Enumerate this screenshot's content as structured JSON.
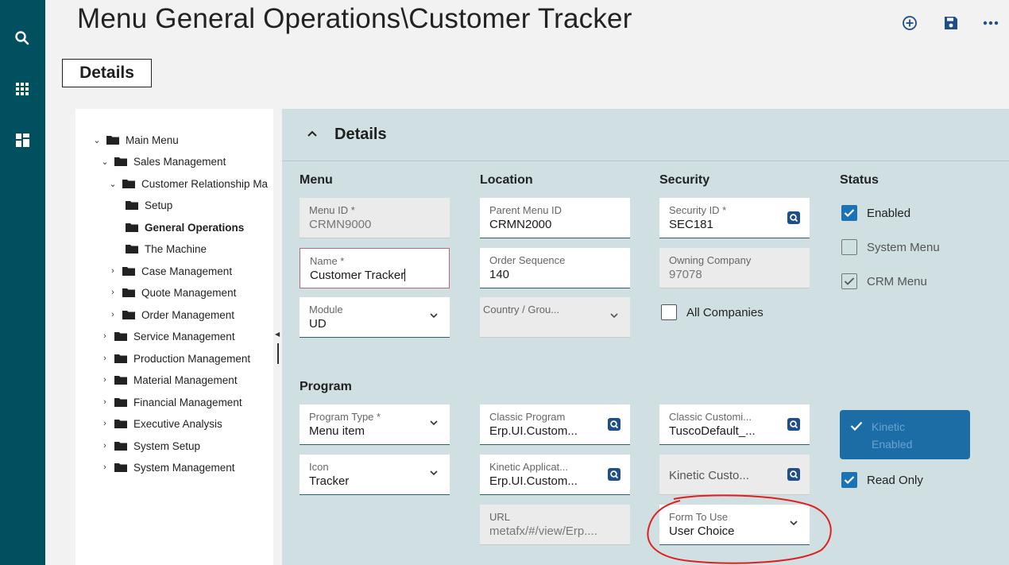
{
  "header": {
    "title": "Menu General Operations\\Customer Tracker",
    "tab": "Details"
  },
  "tree": [
    {
      "label": "Main Menu",
      "expanded": true,
      "bold": false
    },
    {
      "label": "Sales Management",
      "expanded": true,
      "bold": false
    },
    {
      "label": "Customer Relationship Ma",
      "expanded": true,
      "bold": false
    },
    {
      "label": "Setup",
      "bold": false
    },
    {
      "label": "General Operations",
      "bold": true
    },
    {
      "label": "The Machine",
      "bold": false
    },
    {
      "label": "Case Management",
      "expanded": false,
      "bold": false
    },
    {
      "label": "Quote Management",
      "expanded": false,
      "bold": false
    },
    {
      "label": "Order Management",
      "expanded": false,
      "bold": false
    },
    {
      "label": "Service Management",
      "expanded": false,
      "bold": false
    },
    {
      "label": "Production Management",
      "expanded": false,
      "bold": false
    },
    {
      "label": "Material Management",
      "expanded": false,
      "bold": false
    },
    {
      "label": "Financial Management",
      "expanded": false,
      "bold": false
    },
    {
      "label": "Executive Analysis",
      "expanded": false,
      "bold": false
    },
    {
      "label": "System Setup",
      "expanded": false,
      "bold": false
    },
    {
      "label": "System Management",
      "expanded": false,
      "bold": false
    }
  ],
  "panel": {
    "title": "Details",
    "columns": {
      "menu": "Menu",
      "location": "Location",
      "security": "Security",
      "status": "Status",
      "program": "Program"
    },
    "fields": {
      "menu_id": {
        "label": "Menu ID *",
        "value": "CRMN9000"
      },
      "name": {
        "label": "Name *",
        "value": "Customer Tracker"
      },
      "module": {
        "label": "Module",
        "value": "UD"
      },
      "parent_menu_id": {
        "label": "Parent Menu ID",
        "value": "CRMN2000"
      },
      "order_sequence": {
        "label": "Order Sequence",
        "value": "140"
      },
      "country_group": {
        "label": "Country / Grou...",
        "value": ""
      },
      "security_id": {
        "label": "Security ID *",
        "value": "SEC181"
      },
      "owning_company": {
        "label": "Owning Company",
        "value": "97078"
      },
      "program_type": {
        "label": "Program Type *",
        "value": "Menu item"
      },
      "icon": {
        "label": "Icon",
        "value": "Tracker"
      },
      "classic_program": {
        "label": "Classic Program",
        "value": "Erp.UI.Custom..."
      },
      "kinetic_application": {
        "label": "Kinetic Applicat...",
        "value": "Erp.UI.Custom..."
      },
      "url": {
        "label": "URL",
        "value": "metafx/#/view/Erp...."
      },
      "classic_customization": {
        "label": "Classic Customi...",
        "value": "TuscoDefault_..."
      },
      "kinetic_customization": {
        "label": "",
        "value": "Kinetic Custo..."
      },
      "form_to_use": {
        "label": "Form To Use",
        "value": "User Choice"
      }
    },
    "checks": {
      "all_companies": {
        "label": "All Companies",
        "checked": false
      },
      "enabled": {
        "label": "Enabled",
        "checked": true
      },
      "system_menu": {
        "label": "System Menu",
        "checked": false
      },
      "crm_menu": {
        "label": "CRM Menu",
        "checked": true
      },
      "read_only": {
        "label": "Read Only",
        "checked": true
      }
    },
    "kinetic_button": {
      "line1": "Kinetic",
      "line2": "Enabled"
    }
  },
  "colors": {
    "rail": "#00505f",
    "panel": "#cfdfe2",
    "accent": "#1c73b4",
    "annotation": "#e02020"
  }
}
